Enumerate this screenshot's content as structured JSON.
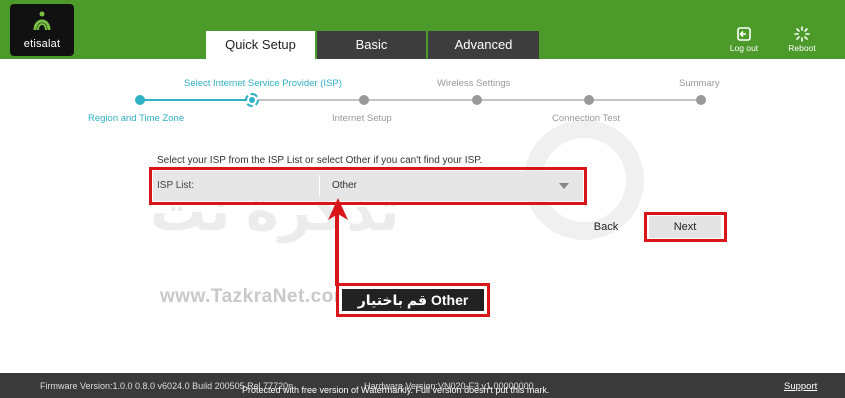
{
  "brand": {
    "logo_text": "etisalat"
  },
  "tabs": [
    {
      "label": "Quick Setup",
      "active": true
    },
    {
      "label": "Basic",
      "active": false
    },
    {
      "label": "Advanced",
      "active": false
    }
  ],
  "header_buttons": {
    "logout": "Log out",
    "reboot": "Reboot"
  },
  "steps": {
    "region": "Region and Time Zone",
    "isp": "Select Internet Service Provider (ISP)",
    "internet": "Internet Setup",
    "wireless": "Wireless Settings",
    "connection": "Connection Test",
    "summary": "Summary"
  },
  "form": {
    "instruction": "Select your ISP from the ISP List or select Other if you can't find your ISP.",
    "isp_label": "ISP List:",
    "isp_value": "Other",
    "back": "Back",
    "next": "Next"
  },
  "annotation": {
    "callout": "قم باختيار Other"
  },
  "watermark": {
    "site": "www.TazkraNet.com",
    "arabic": "تذكرة نت",
    "footer": "Protected with free version of Watermarkly. Full version doesn't put this mark."
  },
  "footer": {
    "firmware": "Firmware Version:1.0.0 0.8.0 v6024.0 Build 200505 Rel.77720n",
    "hardware": "Hardware Version:VN020-F3 v1 00000000",
    "support": "Support"
  },
  "colors": {
    "header_green": "#4c9a2a",
    "accent_teal": "#2fb0c4",
    "annotation_red": "#d8161a",
    "footer": "#3a3a3a"
  }
}
